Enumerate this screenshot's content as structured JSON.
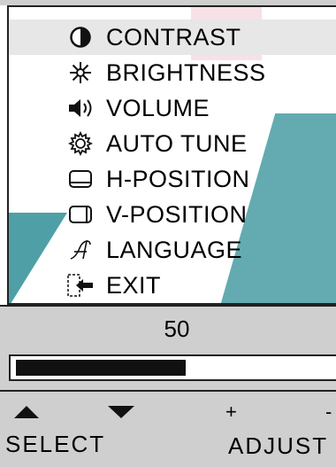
{
  "menu": {
    "items": [
      {
        "icon": "contrast-icon",
        "label": "CONTRAST",
        "selected": true
      },
      {
        "icon": "brightness-icon",
        "label": "BRIGHTNESS",
        "selected": false
      },
      {
        "icon": "volume-icon",
        "label": "VOLUME",
        "selected": false
      },
      {
        "icon": "auto-tune-icon",
        "label": "AUTO TUNE",
        "selected": false
      },
      {
        "icon": "h-position-icon",
        "label": "H-POSITION",
        "selected": false
      },
      {
        "icon": "v-position-icon",
        "label": "V-POSITION",
        "selected": false
      },
      {
        "icon": "language-icon",
        "label": "LANGUAGE",
        "selected": false
      },
      {
        "icon": "exit-icon",
        "label": "EXIT",
        "selected": false
      }
    ]
  },
  "value": {
    "text": "50",
    "level": 0.5
  },
  "controls": {
    "select_label": "SELECT",
    "adjust_label": "ADJUST",
    "plus": "+",
    "minus": "-"
  },
  "colors": {
    "panel_bg": "#ffffff",
    "frame_bg": "#cfcfcf",
    "selected_bg": "#e7e7e7",
    "accent": "#2f8f96",
    "bar_fill": "#111111"
  }
}
